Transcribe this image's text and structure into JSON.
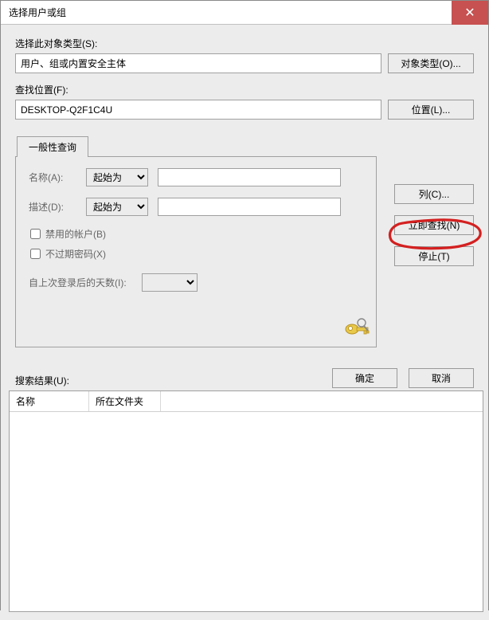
{
  "window": {
    "title": "选择用户或组"
  },
  "object_type": {
    "label": "选择此对象类型(S):",
    "value": "用户、组或内置安全主体",
    "button": "对象类型(O)..."
  },
  "location": {
    "label": "查找位置(F):",
    "value": "DESKTOP-Q2F1C4U",
    "button": "位置(L)..."
  },
  "tabs": {
    "general": "一般性查询"
  },
  "query": {
    "name_label": "名称(A):",
    "name_combo": "起始为",
    "desc_label": "描述(D):",
    "desc_combo": "起始为",
    "disabled_account": "禁用的帐户(B)",
    "password_never_expires": "不过期密码(X)",
    "days_label": "自上次登录后的天数(I):"
  },
  "side": {
    "columns": "列(C)...",
    "find_now": "立即查找(N)",
    "stop": "停止(T)"
  },
  "footer": {
    "ok": "确定",
    "cancel": "取消"
  },
  "results": {
    "label": "搜索结果(U):",
    "col_name": "名称",
    "col_folder": "所在文件夹"
  }
}
